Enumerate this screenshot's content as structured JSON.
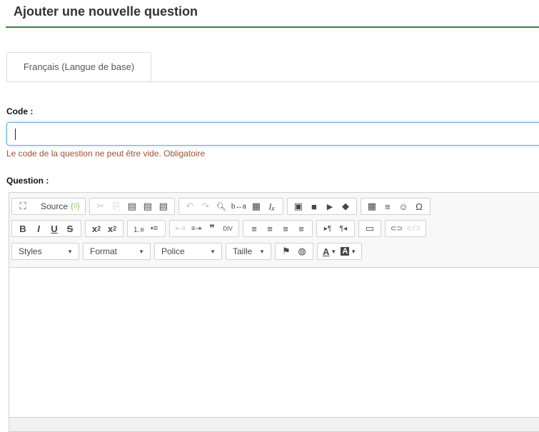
{
  "page": {
    "title": "Ajouter une nouvelle question",
    "accent_color": "#328637"
  },
  "tabs": [
    {
      "label": "Français (Langue de base)",
      "active": true
    }
  ],
  "code_field": {
    "label": "Code :",
    "value": "",
    "error": "Le code de la question ne peut être vide. Obligatoire"
  },
  "question_field": {
    "label": "Question :"
  },
  "toolbar": {
    "source_label": "Source",
    "combos": {
      "styles": "Styles",
      "format": "Format",
      "font": "Police",
      "size": "Taille"
    },
    "icons": {
      "maximize": "⛶",
      "source": "{◊}",
      "cut": "✂",
      "copy": "⎘",
      "paste": "▤",
      "paste_text": "▤",
      "paste_word": "▤",
      "undo": "↶",
      "redo": "↷",
      "find": "🔍︎",
      "replace": "b↔a",
      "select_all": "▦",
      "remove_format": "Iₓ",
      "image": "▣",
      "video": "■",
      "play": "▶",
      "flash": "◆",
      "table": "▦",
      "hr": "≡",
      "smiley": "☺",
      "omega": "Ω",
      "bold": "B",
      "italic": "I",
      "underline": "U",
      "strike": "S",
      "subscript": "x",
      "superscript": "x",
      "numbered_list": "⒈≡",
      "bullet_list": "•≡",
      "outdent": "⇤≡",
      "indent": "≡⇥",
      "blockquote": "❞",
      "div": "DIV",
      "align_left": "≡",
      "align_center": "≡",
      "align_right": "≡",
      "justify": "≡",
      "ltr": "▸¶",
      "rtl": "¶◂",
      "template": "▭",
      "link": "⊂⊃",
      "unlink": "⊂/⊃",
      "anchor": "⚑",
      "globe": "◍",
      "text_color": "A",
      "bg_color": "A"
    }
  }
}
